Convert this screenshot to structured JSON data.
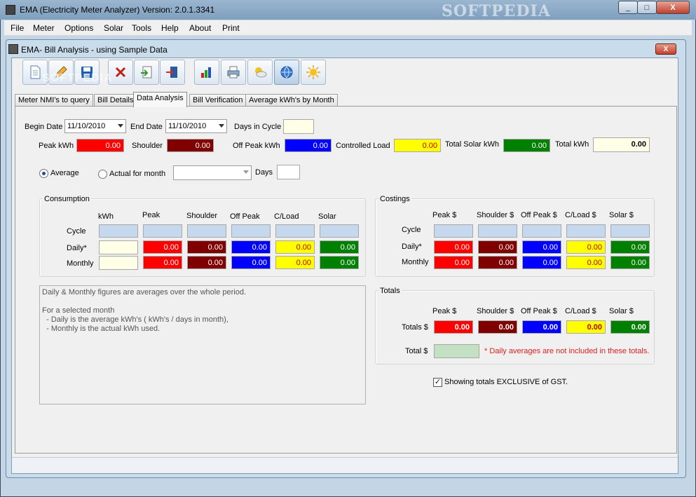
{
  "window": {
    "title": "EMA (Electricity Meter Analyzer) Version: 2.0.1.3341",
    "watermark": "SOFTPEDIA",
    "minimize": "_",
    "maximize": "□",
    "close": "X"
  },
  "menu": [
    "File",
    "Meter",
    "Options",
    "Solar",
    "Tools",
    "Help",
    "About",
    "Print"
  ],
  "child_window": {
    "title": "EMA- Bill Analysis - using Sample Data",
    "close": "X",
    "watermark": "SOFTPEDIA"
  },
  "toolbar": {
    "icons": [
      "new-document-icon",
      "edit-pencil-icon",
      "save-disk-icon",
      "delete-x-icon",
      "import-icon",
      "exit-door-icon",
      "bar-chart-icon",
      "printer-icon",
      "weather-sun-cloud-icon",
      "globe-icon",
      "sun-icon"
    ]
  },
  "tabs": [
    "Meter NMI's to query",
    "Bill Details",
    "Data Analysis",
    "Bill Verification",
    "Average kWh's by Month"
  ],
  "selected_tab": "Data Analysis",
  "filters": {
    "begin_date_label": "Begin Date",
    "begin_date": "11/10/2010",
    "end_date_label": "End Date",
    "end_date": "11/10/2010",
    "days_in_cycle_label": "Days in Cycle",
    "days_in_cycle": ""
  },
  "summary": {
    "peak_label": "Peak kWh",
    "peak": "0.00",
    "shoulder_label": "Shoulder",
    "shoulder": "0.00",
    "offpeak_label": "Off Peak kWh",
    "offpeak": "0.00",
    "controlled_label": "Controlled Load",
    "controlled": "0.00",
    "solar_label": "Total Solar kWh",
    "solar": "0.00",
    "total_label": "Total kWh",
    "total": "0.00"
  },
  "mode": {
    "average_label": "Average",
    "average_selected": true,
    "actual_label": "Actual for month",
    "month_value": "",
    "days_label": "Days",
    "days_value": ""
  },
  "consumption": {
    "title": "Consumption",
    "headers": [
      "kWh",
      "Peak",
      "Shoulder",
      "Off Peak",
      "C/Load",
      "Solar"
    ],
    "rows": [
      {
        "label": "Cycle",
        "values": [
          "",
          "",
          "",
          "",
          "",
          ""
        ]
      },
      {
        "label": "Daily*",
        "values": [
          "",
          "0.00",
          "0.00",
          "0.00",
          "0.00",
          "0.00"
        ]
      },
      {
        "label": "Monthly",
        "values": [
          "",
          "0.00",
          "0.00",
          "0.00",
          "0.00",
          "0.00"
        ]
      }
    ]
  },
  "costings": {
    "title": "Costings",
    "headers": [
      "Peak  $",
      "Shoulder  $",
      "Off Peak  $",
      "C/Load  $",
      "Solar  $"
    ],
    "rows": [
      {
        "label": "Cycle",
        "values": [
          "",
          "",
          "",
          "",
          ""
        ]
      },
      {
        "label": "Daily*",
        "values": [
          "0.00",
          "0.00",
          "0.00",
          "0.00",
          "0.00"
        ]
      },
      {
        "label": "Monthly",
        "values": [
          "0.00",
          "0.00",
          "0.00",
          "0.00",
          "0.00"
        ]
      }
    ]
  },
  "totals": {
    "title": "Totals",
    "headers": [
      "Peak  $",
      "Shoulder  $",
      "Off Peak  $",
      "C/Load  $",
      "Solar  $"
    ],
    "row_label": "Totals $",
    "values": [
      "0.00",
      "0.00",
      "0.00",
      "0.00",
      "0.00"
    ],
    "total_label": "Total $",
    "total_value": "",
    "note": "* Daily averages are not included in these totals."
  },
  "notes": [
    "Daily & Monthly figures are averages over the whole period.",
    "",
    "For a selected month",
    "  - Daily is the average kWh's ( kWh's / days in month),",
    "  - Monthly is the actual kWh used."
  ],
  "gst": {
    "label": "Showing totals EXCLUSIVE of GST.",
    "checked": true,
    "checkmark": "✓"
  },
  "colors": {
    "peak": "#ff0000",
    "shoulder": "#800000",
    "offpeak": "#0000ff",
    "controlled_load": "#ffff00",
    "solar": "#008000"
  }
}
